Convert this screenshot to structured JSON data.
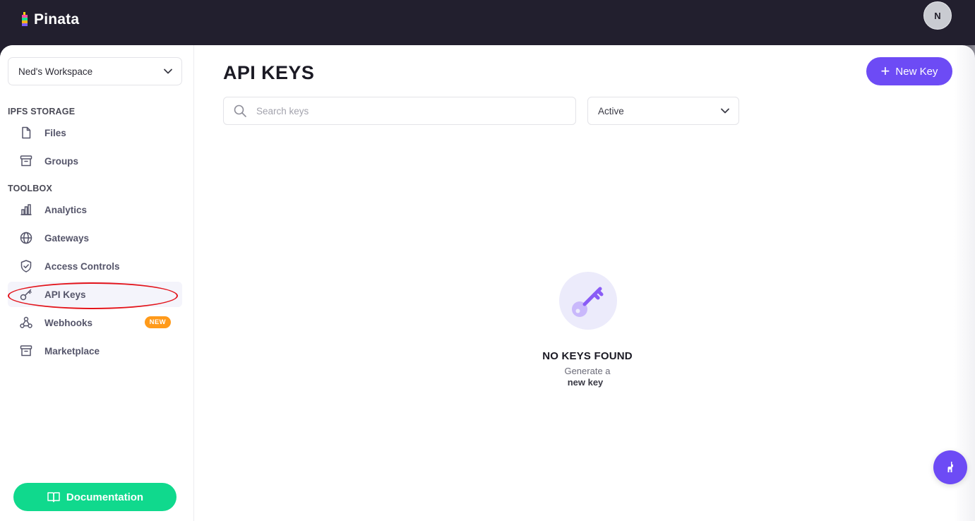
{
  "app": {
    "brand": "Pinata",
    "user_initial": "N"
  },
  "sidebar": {
    "workspace": "Ned's Workspace",
    "sections": {
      "ipfs_storage": "IPFS STORAGE",
      "toolbox": "TOOLBOX"
    },
    "items": [
      {
        "label": "Files",
        "icon": "file-icon"
      },
      {
        "label": "Groups",
        "icon": "archive-icon"
      },
      {
        "label": "Analytics",
        "icon": "bar-chart-icon"
      },
      {
        "label": "Gateways",
        "icon": "globe-icon"
      },
      {
        "label": "Access Controls",
        "icon": "shield-check-icon"
      },
      {
        "label": "API Keys",
        "icon": "key-icon",
        "active": true
      },
      {
        "label": "Webhooks",
        "icon": "webhook-icon",
        "badge": "NEW"
      },
      {
        "label": "Marketplace",
        "icon": "archive-icon"
      }
    ],
    "documentation_label": "Documentation"
  },
  "main": {
    "title": "API KEYS",
    "new_key_label": "New Key",
    "search_placeholder": "Search keys",
    "status_filter": "Active",
    "empty": {
      "title": "NO KEYS FOUND",
      "subtitle": "Generate a",
      "link": "new key"
    }
  },
  "colors": {
    "topbar": "#221f2e",
    "accent": "#6d4bf5",
    "documentation_button": "#10d98d",
    "new_badge": "#ff9a1a",
    "annotation_ring": "#e3141b"
  }
}
